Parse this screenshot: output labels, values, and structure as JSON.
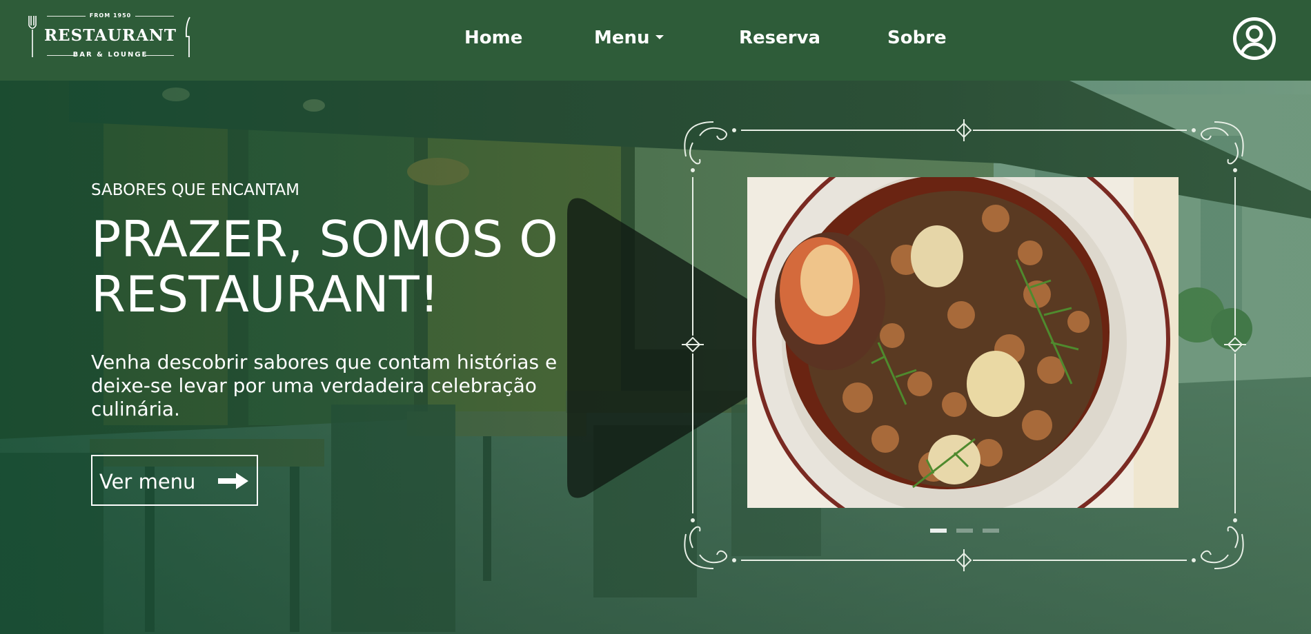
{
  "brand": {
    "from": "FROM 1950",
    "name": "RESTAURANT",
    "tagline": "BAR & LOUNGE"
  },
  "nav": {
    "home": "Home",
    "menu": "Menu",
    "reserva": "Reserva",
    "sobre": "Sobre"
  },
  "hero": {
    "eyebrow": "SABORES QUE ENCANTAM",
    "headline": "PRAZER, SOMOS O RESTAURANT!",
    "intro": "Venha descobrir sabores que contam histórias e deixe-se levar por uma verdadeira celebração culinária.",
    "cta_label": "Ver menu"
  },
  "carousel": {
    "slide_count": 3,
    "active_index": 0
  },
  "icons": {
    "user": "user-circle-icon",
    "arrow": "arrow-right-icon",
    "caret": "caret-down-icon",
    "play": "play-icon"
  },
  "colors": {
    "header_bg": "#2e5c39",
    "overlay": "#1f6b43",
    "text": "#ffffff"
  }
}
